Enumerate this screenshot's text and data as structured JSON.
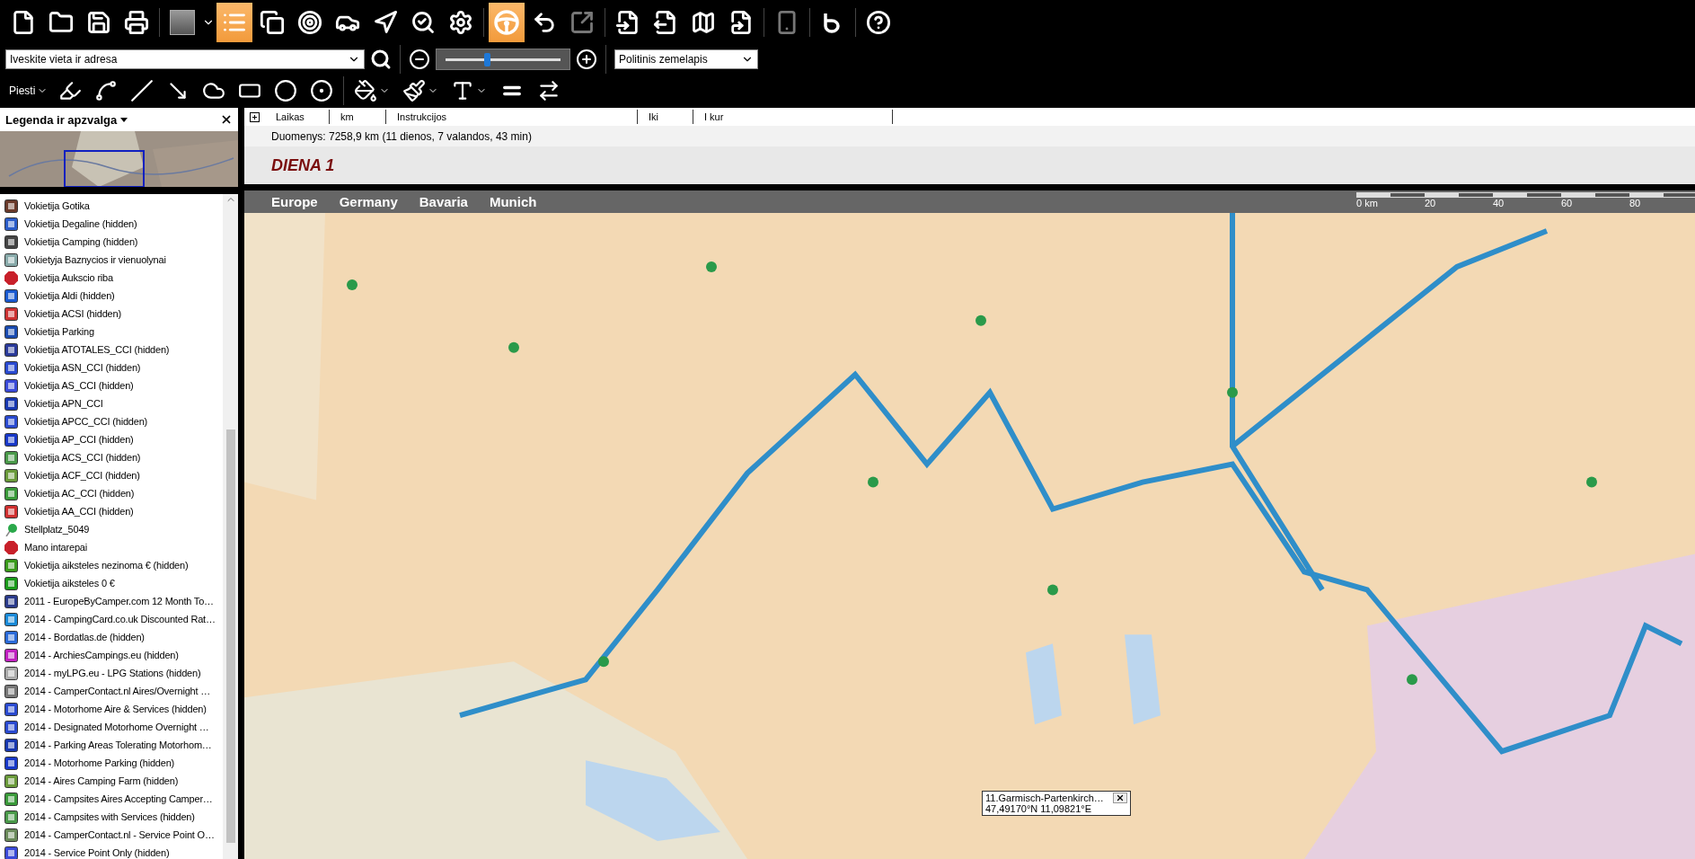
{
  "toolbar": {
    "buttons": [
      {
        "selected": false,
        "disabled": false
      },
      {
        "selected": false,
        "disabled": false
      },
      {
        "selected": false,
        "disabled": false
      },
      {
        "selected": false,
        "disabled": false
      },
      {
        "selected": false,
        "disabled": false
      },
      {
        "selected": true,
        "disabled": false
      },
      {
        "selected": false,
        "disabled": false
      },
      {
        "selected": false,
        "disabled": false
      },
      {
        "selected": false,
        "disabled": false
      },
      {
        "selected": false,
        "disabled": false
      },
      {
        "selected": false,
        "disabled": false
      },
      {
        "selected": false,
        "disabled": false
      },
      {
        "selected": true,
        "disabled": false
      },
      {
        "selected": false,
        "disabled": false
      },
      {
        "selected": false,
        "disabled": true
      },
      {
        "selected": false,
        "disabled": false
      },
      {
        "selected": false,
        "disabled": false
      },
      {
        "selected": false,
        "disabled": false
      },
      {
        "selected": false,
        "disabled": false
      },
      {
        "selected": false,
        "disabled": true
      },
      {
        "selected": false,
        "disabled": false
      },
      {
        "selected": false,
        "disabled": false
      }
    ]
  },
  "search": {
    "placeholder": "Iveskite vieta ir adresa"
  },
  "zoom": {
    "level": 0.36
  },
  "map_type": {
    "value": "Politinis zemelapis"
  },
  "draw_toolbar": {
    "label": "Piesti"
  },
  "legend": {
    "title": "Legenda ir apzvalga",
    "items": [
      {
        "label": "Vokietija Gotika"
      },
      {
        "label": "Vokietija Degaline (hidden)"
      },
      {
        "label": "Vokietija Camping (hidden)"
      },
      {
        "label": "Vokietyja Baznycios ir vienuolynai"
      },
      {
        "label": "Vokietija Aukscio riba"
      },
      {
        "label": "Vokietija Aldi (hidden)"
      },
      {
        "label": "Vokietija ACSI (hidden)"
      },
      {
        "label": "Vokietija  Parking"
      },
      {
        "label": "Vokietija ATOTALES_CCI (hidden)"
      },
      {
        "label": "Vokietija ASN_CCI (hidden)"
      },
      {
        "label": "Vokietija AS_CCI (hidden)"
      },
      {
        "label": "Vokietija APN_CCI"
      },
      {
        "label": "Vokietija APCC_CCI (hidden)"
      },
      {
        "label": "Vokietija AP_CCI (hidden)"
      },
      {
        "label": "Vokietija ACS_CCI (hidden)"
      },
      {
        "label": "Vokietija ACF_CCI (hidden)"
      },
      {
        "label": "Vokietija AC_CCI (hidden)"
      },
      {
        "label": "Vokietija AA_CCI (hidden)"
      },
      {
        "label": "Stellplatz_5049"
      },
      {
        "label": "Mano intarepai"
      },
      {
        "label": "Vokietija aiksteles nezinoma € (hidden)"
      },
      {
        "label": "Vokietija aiksteles 0 €"
      },
      {
        "label": "2011 - EuropeByCamper.com 12 Month To…"
      },
      {
        "label": "2014 - CampingCard.co.uk Discounted Rat…"
      },
      {
        "label": "2014 - Bordatlas.de (hidden)"
      },
      {
        "label": "2014 - ArchiesCampings.eu (hidden)"
      },
      {
        "label": "2014 - myLPG.eu - LPG Stations (hidden)"
      },
      {
        "label": "2014 - CamperContact.nl Aires/Overnight …"
      },
      {
        "label": "2014 - Motorhome Aire & Services (hidden)"
      },
      {
        "label": "2014 - Designated Motorhome Overnight …"
      },
      {
        "label": "2014 - Parking Areas Tolerating Motorhom…"
      },
      {
        "label": "2014 - Motorhome Parking (hidden)"
      },
      {
        "label": "2014 - Aires Camping Farm (hidden)"
      },
      {
        "label": "2014 - Campsites Aires Accepting Camper…"
      },
      {
        "label": "2014 - Campsites with Services (hidden)"
      },
      {
        "label": "2014 - CamperContact.nl - Service Point O…"
      },
      {
        "label": "2014 - Service Point Only (hidden)"
      }
    ]
  },
  "route_table": {
    "columns": [
      "Laikas",
      "km",
      "Instrukcijos",
      "Iki",
      "I kur"
    ],
    "summary": "Duomenys:  7258,9 km (11 dienos, 7 valandos, 43 min)",
    "day": "DIENA 1"
  },
  "map": {
    "breadcrumb": [
      "Europe",
      "Germany",
      "Bavaria",
      "Munich"
    ],
    "scale_labels": [
      "0 km",
      "20",
      "40",
      "60",
      "80"
    ],
    "popup": {
      "title": "11.Garmisch-Partenkirch…",
      "coords": "47,49170°N 11,09821°E"
    }
  }
}
